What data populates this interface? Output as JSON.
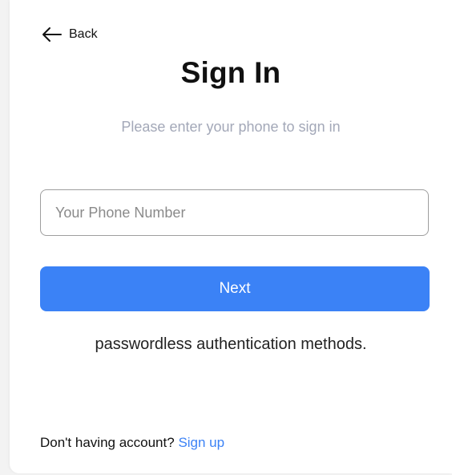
{
  "header": {
    "back_label": "Back",
    "back_icon": "arrow-left-icon"
  },
  "main": {
    "title": "Sign In",
    "subtitle": "Please enter your phone to sign in",
    "phone_placeholder": "Your Phone Number",
    "phone_value": "",
    "next_label": "Next",
    "passwordless_text": "passwordless authentication methods."
  },
  "footer": {
    "prompt": "Don't having account?",
    "signup_label": "Sign up"
  },
  "colors": {
    "accent": "#3b82f6",
    "subtitle": "#a3a8b8",
    "text": "#111111"
  }
}
